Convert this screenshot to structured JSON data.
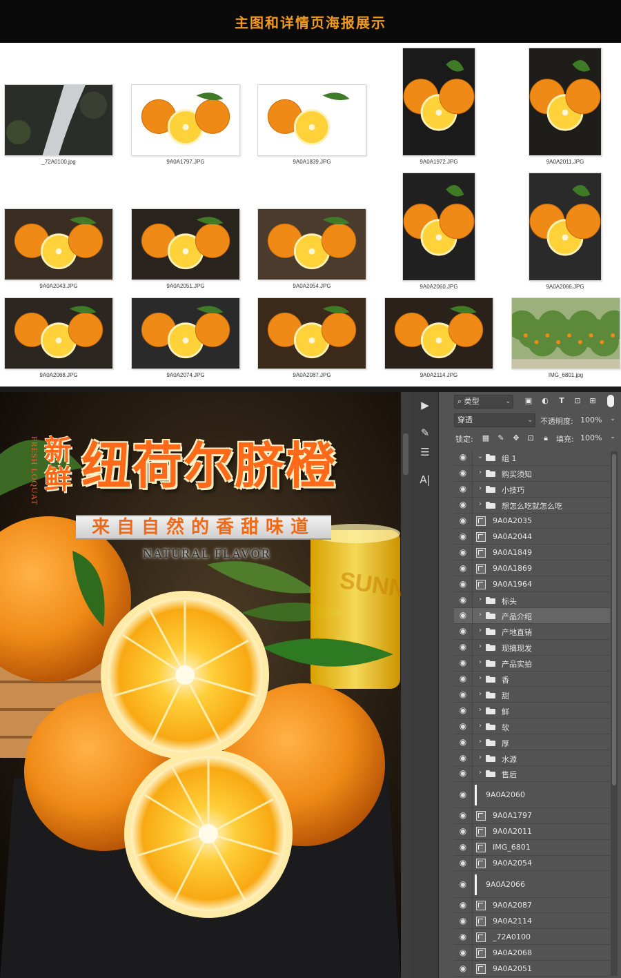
{
  "header": {
    "title": "主图和详情页海报展示"
  },
  "gallery": {
    "thumbnails": [
      {
        "name": "_72A0100.jpg"
      },
      {
        "name": "9A0A1797.JPG"
      },
      {
        "name": "9A0A1839.JPG"
      },
      {
        "name": "9A0A1972.JPG"
      },
      {
        "name": "9A0A2011.JPG"
      },
      {
        "name": "9A0A2043.JPG"
      },
      {
        "name": "9A0A2051.JPG"
      },
      {
        "name": "9A0A2054.JPG"
      },
      {
        "name": "9A0A2060.JPG"
      },
      {
        "name": "9A0A2066.JPG"
      },
      {
        "name": "9A0A2068.JPG"
      },
      {
        "name": "9A0A2074.JPG"
      },
      {
        "name": "9A0A2087.JPG"
      },
      {
        "name": "9A0A2114.JPG"
      },
      {
        "name": "IMG_6801.jpg"
      }
    ]
  },
  "poster": {
    "vertical_en": "FRESH LOQUAT",
    "xin_xian": "新鲜",
    "main_title": "纽荷尔脐橙",
    "subtitle": "来自自然的香甜味道",
    "english": "NATURAL FLAVOR",
    "glass_text": "SUNNY"
  },
  "photoshop": {
    "filter_label": "类型",
    "blend_mode": "穿透",
    "opacity_label": "不透明度:",
    "opacity_value": "100%",
    "lock_label": "锁定:",
    "fill_label": "填充:",
    "fill_value": "100%",
    "layers": [
      {
        "name": "组 1",
        "type": "group",
        "expanded": true
      },
      {
        "name": "购买须知",
        "type": "group"
      },
      {
        "name": "小技巧",
        "type": "group"
      },
      {
        "name": "想怎么吃就怎么吃",
        "type": "group"
      },
      {
        "name": "9A0A2035",
        "type": "smart"
      },
      {
        "name": "9A0A2044",
        "type": "smart"
      },
      {
        "name": "9A0A1849",
        "type": "smart"
      },
      {
        "name": "9A0A1869",
        "type": "smart"
      },
      {
        "name": "9A0A1964",
        "type": "smart"
      },
      {
        "name": "标头",
        "type": "group"
      },
      {
        "name": "产品介绍",
        "type": "group",
        "active": true
      },
      {
        "name": "产地直销",
        "type": "group"
      },
      {
        "name": "现摘现发",
        "type": "group"
      },
      {
        "name": "产品实拍",
        "type": "group"
      },
      {
        "name": "香",
        "type": "group"
      },
      {
        "name": "甜",
        "type": "group"
      },
      {
        "name": "鲜",
        "type": "group"
      },
      {
        "name": "软",
        "type": "group"
      },
      {
        "name": "厚",
        "type": "group"
      },
      {
        "name": "水源",
        "type": "group"
      },
      {
        "name": "售后",
        "type": "group"
      },
      {
        "name": "9A0A2060",
        "type": "tall"
      },
      {
        "name": "9A0A1797",
        "type": "smart"
      },
      {
        "name": "9A0A2011",
        "type": "smart"
      },
      {
        "name": "IMG_6801",
        "type": "smart"
      },
      {
        "name": "9A0A2054",
        "type": "smart"
      },
      {
        "name": "9A0A2066",
        "type": "tall"
      },
      {
        "name": "9A0A2087",
        "type": "smart"
      },
      {
        "name": "9A0A2114",
        "type": "smart"
      },
      {
        "name": "_72A0100",
        "type": "smart"
      },
      {
        "name": "9A0A2068",
        "type": "smart"
      },
      {
        "name": "9A0A2051",
        "type": "smart"
      }
    ]
  }
}
